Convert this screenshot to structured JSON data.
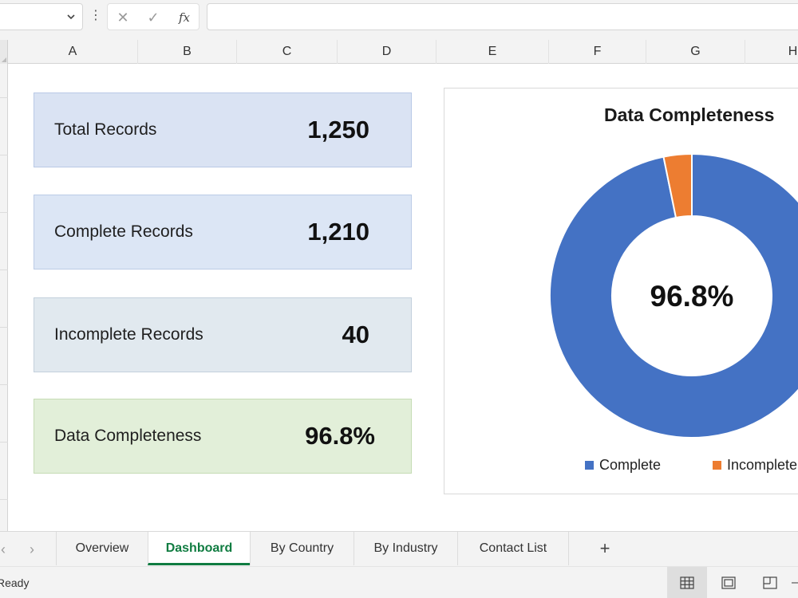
{
  "formula_bar": {
    "more_glyph": "⋮",
    "cancel_glyph": "✕",
    "enter_glyph": "✓",
    "fx_label": "fx"
  },
  "columns": [
    "A",
    "B",
    "C",
    "D",
    "E",
    "F",
    "G",
    "H"
  ],
  "kpis": {
    "total": {
      "label": "Total Records",
      "value": "1,250"
    },
    "complete": {
      "label": "Complete Records",
      "value": "1,210"
    },
    "incomplete": {
      "label": "Incomplete Records",
      "value": "40"
    },
    "completeness": {
      "label": "Data Completeness",
      "value": "96.8%"
    }
  },
  "chart": {
    "title": "Data Completeness",
    "center_label": "96.8%",
    "legend": [
      "Complete",
      "Incomplete"
    ]
  },
  "chart_data": {
    "type": "pie",
    "title": "Data Completeness",
    "categories": [
      "Complete",
      "Incomplete"
    ],
    "values": [
      1210,
      40
    ],
    "colors": [
      "#4472c4",
      "#ed7d31"
    ],
    "legend_position": "bottom"
  },
  "tabs": {
    "prev_glyph": "‹",
    "next_glyph": "›",
    "items": [
      "Overview",
      "Dashboard",
      "By Country",
      "By Industry",
      "Contact List"
    ],
    "active": "Dashboard",
    "add_glyph": "+"
  },
  "status": {
    "text": "Ready"
  },
  "colors": {
    "accent": "#107c41",
    "complete": "#4472c4",
    "incomplete": "#ed7d31"
  }
}
